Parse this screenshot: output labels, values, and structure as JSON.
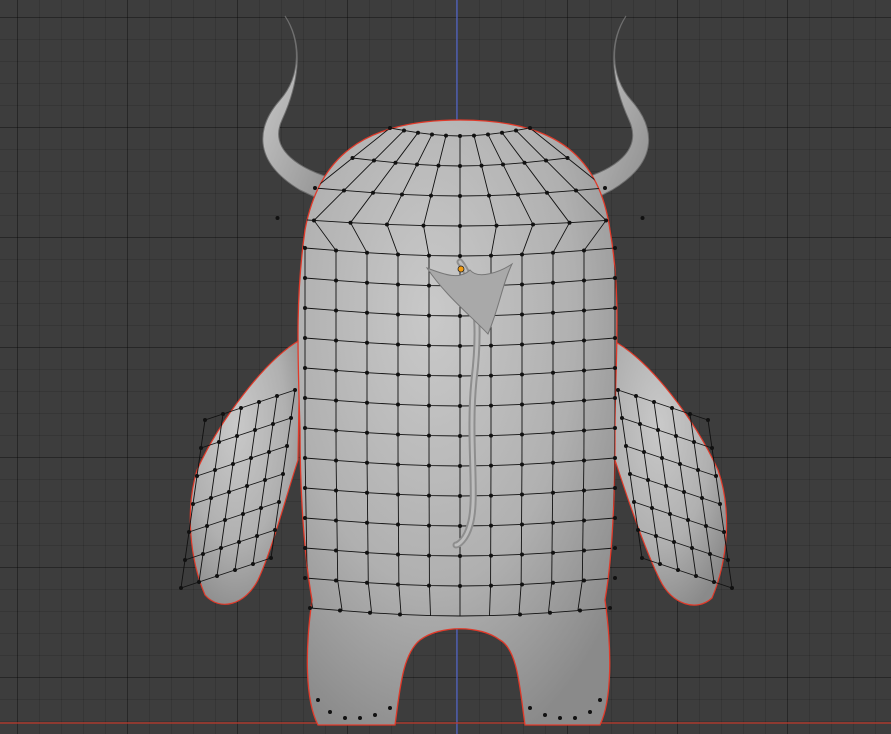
{
  "viewport": {
    "background_color": "#3d3d3d",
    "grid_line_color": "#353535",
    "axis_x_color": "#c0392b",
    "axis_z_color": "#5b6fd6"
  },
  "model": {
    "surface_color": "#b3b3b3",
    "wire_color": "#111111",
    "selection_outline_color": "#e03a2a",
    "active_vertex_color": "#f39c12"
  }
}
